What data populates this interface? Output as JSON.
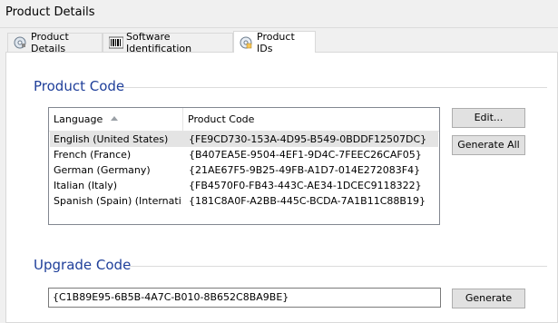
{
  "window": {
    "title": "Product Details"
  },
  "tabs": [
    {
      "label": "Product Details",
      "icon": "gear-cd-icon",
      "active": false
    },
    {
      "label": "Software Identification",
      "icon": "barcode-icon",
      "active": false
    },
    {
      "label": "Product IDs",
      "icon": "disc-id-icon",
      "active": true
    }
  ],
  "product_code": {
    "heading": "Product Code",
    "columns": {
      "language": "Language",
      "code": "Product Code"
    },
    "rows": [
      {
        "language": "English (United States)",
        "code": "{FE9CD730-153A-4D95-B549-0BDDF12507DC}",
        "selected": true
      },
      {
        "language": "French (France)",
        "code": "{B407EA5E-9504-4EF1-9D4C-7FEEC26CAF05}",
        "selected": false
      },
      {
        "language": "German (Germany)",
        "code": "{21AE67F5-9B25-49FB-A1D7-014E272083F4}",
        "selected": false
      },
      {
        "language": "Italian (Italy)",
        "code": "{FB4570F0-FB43-443C-AE34-1DCEC9118322}",
        "selected": false
      },
      {
        "language": "Spanish (Spain) (Internati...",
        "code": "{181C8A0F-A2BB-445C-BCDA-7A1B11C88B19}",
        "selected": false
      }
    ],
    "edit_label": "Edit...",
    "generate_all_label": "Generate All"
  },
  "upgrade_code": {
    "heading": "Upgrade Code",
    "value": "{C1B89E95-6B5B-4A7C-B010-8B652C8BA9BE}",
    "generate_label": "Generate"
  },
  "colors": {
    "heading": "#1f3f9a",
    "selection": "#e4e4e4"
  }
}
